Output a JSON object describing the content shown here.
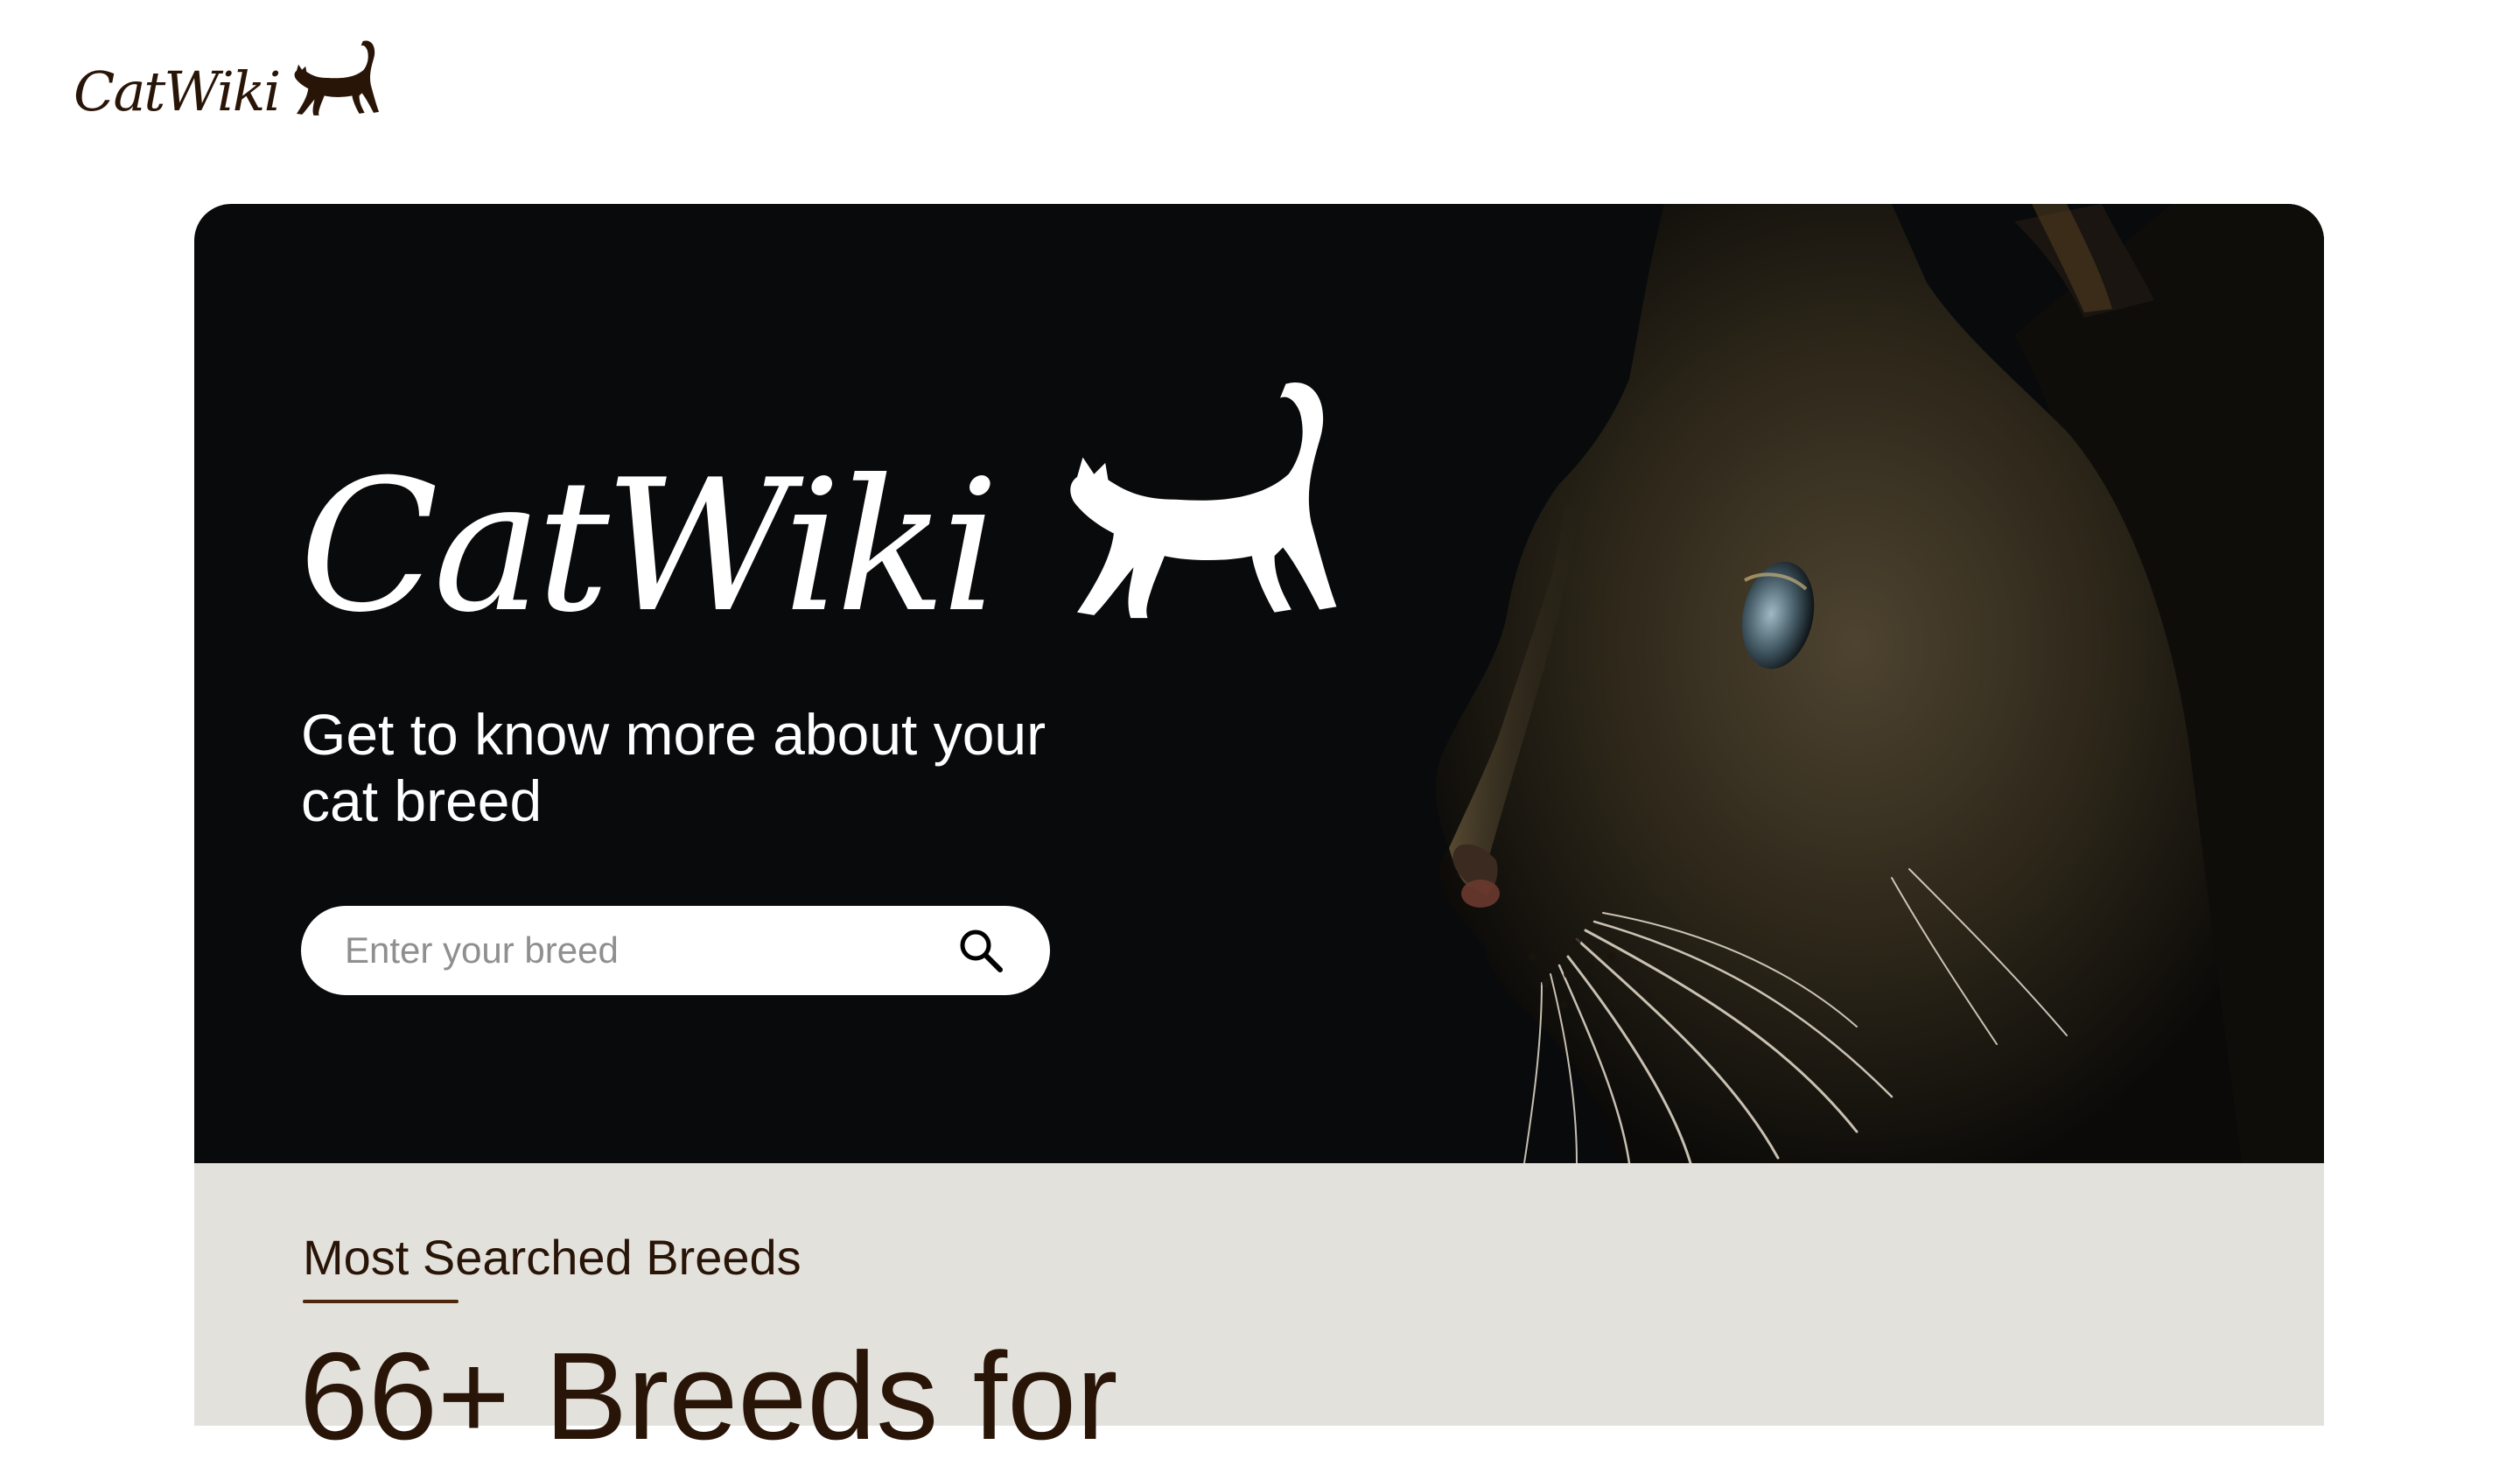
{
  "header": {
    "logo_text": "CatWiki"
  },
  "hero": {
    "logo_text": "CatWiki",
    "tagline": "Get to know more about your cat breed",
    "search": {
      "placeholder": "Enter your breed",
      "value": "",
      "icon": "search-icon"
    }
  },
  "breeds": {
    "subtitle": "Most Searched Breeds",
    "headline": "66+ Breeds for"
  },
  "colors": {
    "brand_dark": "#291507",
    "hero_bg": "#090a0c",
    "section_bg": "#e3e1dc",
    "accent": "#4d270c"
  }
}
